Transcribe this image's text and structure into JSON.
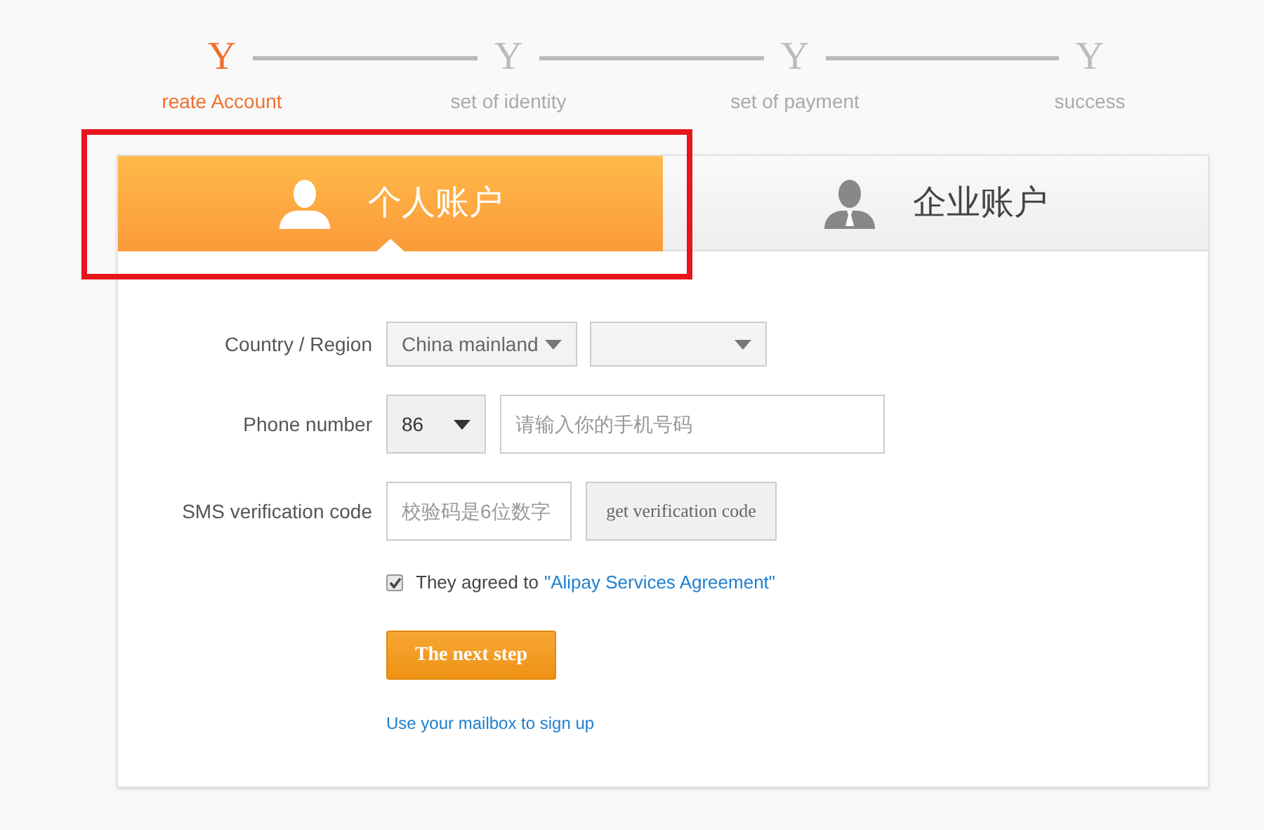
{
  "steps": [
    {
      "mark": "Y",
      "label": "reate Account",
      "selected": true
    },
    {
      "mark": "Y",
      "label": "set of identity",
      "selected": false
    },
    {
      "mark": "Y",
      "label": "set of payment",
      "selected": false
    },
    {
      "mark": "Y",
      "label": "success",
      "selected": false
    }
  ],
  "tabs": [
    {
      "label": "个人账户",
      "kind": "personal",
      "selected": true
    },
    {
      "label": "企业账户",
      "kind": "business",
      "selected": false
    }
  ],
  "form": {
    "country": {
      "label": "Country / Region",
      "value": "China mainland"
    },
    "phone": {
      "label": "Phone number",
      "code": "86",
      "placeholder": "请输入你的手机号码"
    },
    "sms": {
      "label": "SMS verification code",
      "placeholder": "校验码是6位数字",
      "button": "get verification code"
    },
    "agreement": {
      "checked": true,
      "text": "They agreed to",
      "link": "\"Alipay Services Agreement\""
    },
    "submit": "The next step",
    "alt_link": "Use your mailbox to sign up"
  },
  "highlight": {
    "shown": true
  }
}
